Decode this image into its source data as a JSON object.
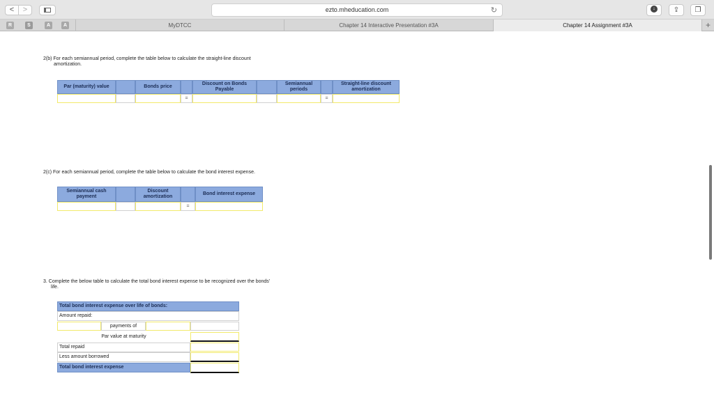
{
  "browser": {
    "url": "ezto.mheducation.com",
    "tabs": [
      "MyDTCC",
      "Chapter 14 Interactive Presentation #3A",
      "Chapter 14 Assignment #3A"
    ],
    "favorites": [
      "R",
      "S",
      "A",
      "A"
    ],
    "icons": {
      "back": "chevron-left-icon",
      "forward": "chevron-right-icon",
      "sidebar": "sidebar-icon",
      "reload": "reload-icon",
      "download": "download-icon",
      "share": "share-icon",
      "tabs": "tabs-icon",
      "add_tab": "plus-icon"
    },
    "glyphs": {
      "back": "<",
      "forward": ">",
      "reload": "↻",
      "download": "↓",
      "share": "⇪",
      "tabs": "❐",
      "add_tab": "+"
    }
  },
  "section_2b": {
    "prompt_line1": "2(b) For each semiannual period, complete the table below to calculate the straight-line discount",
    "prompt_line2": "amortization.",
    "headers": [
      "Par (maturity) value",
      "Bonds price",
      "Discount on Bonds Payable",
      "Semiannual periods",
      "Straight-line discount amortization"
    ],
    "equals_1": "=",
    "equals_2": "="
  },
  "section_2c": {
    "prompt": "2(c) For each semiannual period, complete the table below to calculate the bond interest expense.",
    "headers": [
      "Semiannual cash payment",
      "Discount amortization",
      "Bond interest expense"
    ],
    "equals": "="
  },
  "section_3": {
    "prompt_line1": "3.  Complete the below table to calculate the total bond interest expense to be recognized over the bonds'",
    "prompt_line2": "life.",
    "table_title": "Total bond interest expense over life of bonds:",
    "amount_repaid": "Amount repaid:",
    "payments_of": "payments of",
    "par_value": "Par value at maturity",
    "total_repaid": "Total repaid",
    "less_borrowed": "Less amount borrowed",
    "total_expense": "Total bond interest expense"
  },
  "colors": {
    "header_fill": "#8caade",
    "input_border": "#f2ea6a"
  }
}
